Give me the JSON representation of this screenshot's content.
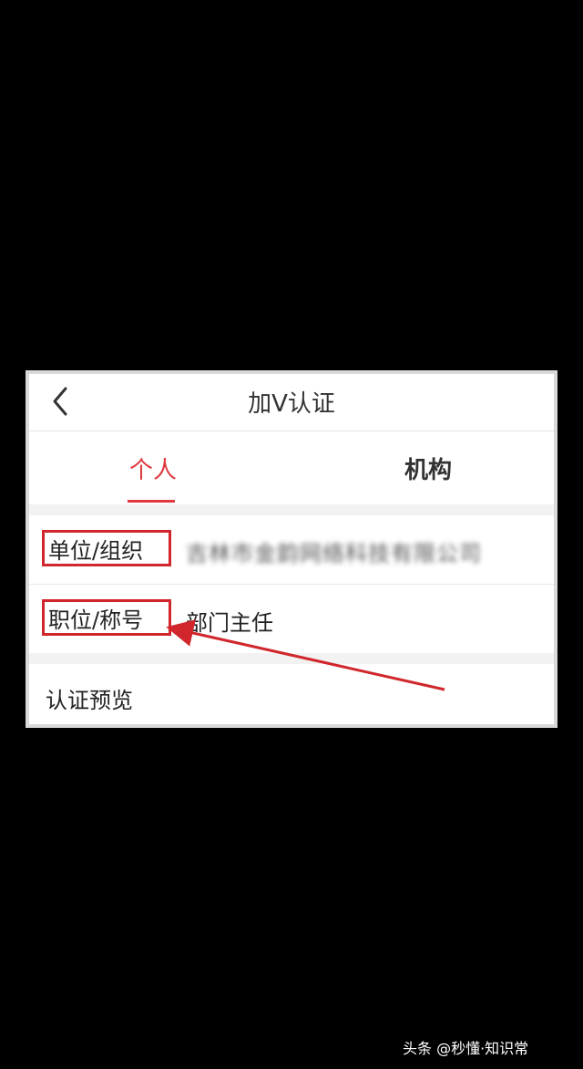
{
  "nav": {
    "title": "加V认证"
  },
  "tabs": [
    {
      "label": "个人",
      "active": true
    },
    {
      "label": "机构",
      "active": false
    }
  ],
  "form": {
    "org_label": "单位/组织",
    "org_value": "吉林市金韵网络科技有限公司",
    "title_label": "职位/称号",
    "title_value": "部门主任"
  },
  "preview": {
    "label": "认证预览"
  },
  "watermark": "头条 @秒懂·知识常",
  "colors": {
    "accent": "#e0383e",
    "highlight_box": "#d0262c",
    "background": "#000000"
  }
}
